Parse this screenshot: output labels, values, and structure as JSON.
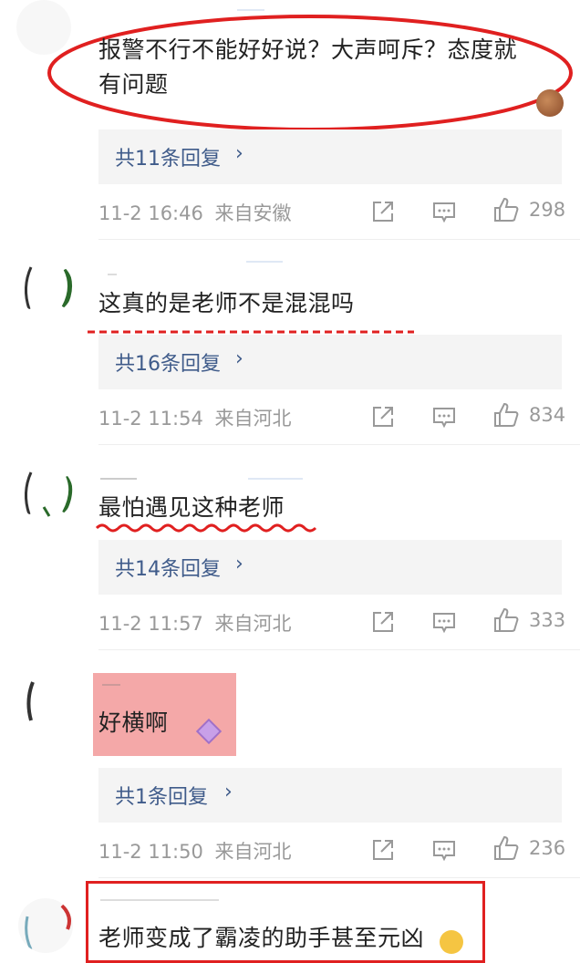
{
  "comments": [
    {
      "text_line1": "报警不行不能好好说？大声呵斥？态度就",
      "text_line2": "有问题",
      "reply_label": "共11条回复",
      "date": "11-2 16:46",
      "location": "来自安徽",
      "likes": "298"
    },
    {
      "text": "这真的是老师不是混混吗",
      "reply_label": "共16条回复",
      "date": "11-2 11:54",
      "location": "来自河北",
      "likes": "834"
    },
    {
      "text": "最怕遇见这种老师",
      "reply_label": "共14条回复",
      "date": "11-2 11:57",
      "location": "来自河北",
      "likes": "333"
    },
    {
      "text": "好横啊",
      "reply_label": "共1条回复",
      "date": "11-2 11:50",
      "location": "来自河北",
      "likes": "236"
    },
    {
      "text": "老师变成了霸凌的助手甚至元凶"
    }
  ],
  "icons": {
    "share": "share-icon",
    "comment": "comment-icon",
    "like": "thumbs-up-icon",
    "chevron": "chevron-right-icon"
  },
  "colors": {
    "reply_link": "#3f5b8a",
    "annotation_red": "#e02020",
    "pink_highlight": "#f4a8a8"
  }
}
